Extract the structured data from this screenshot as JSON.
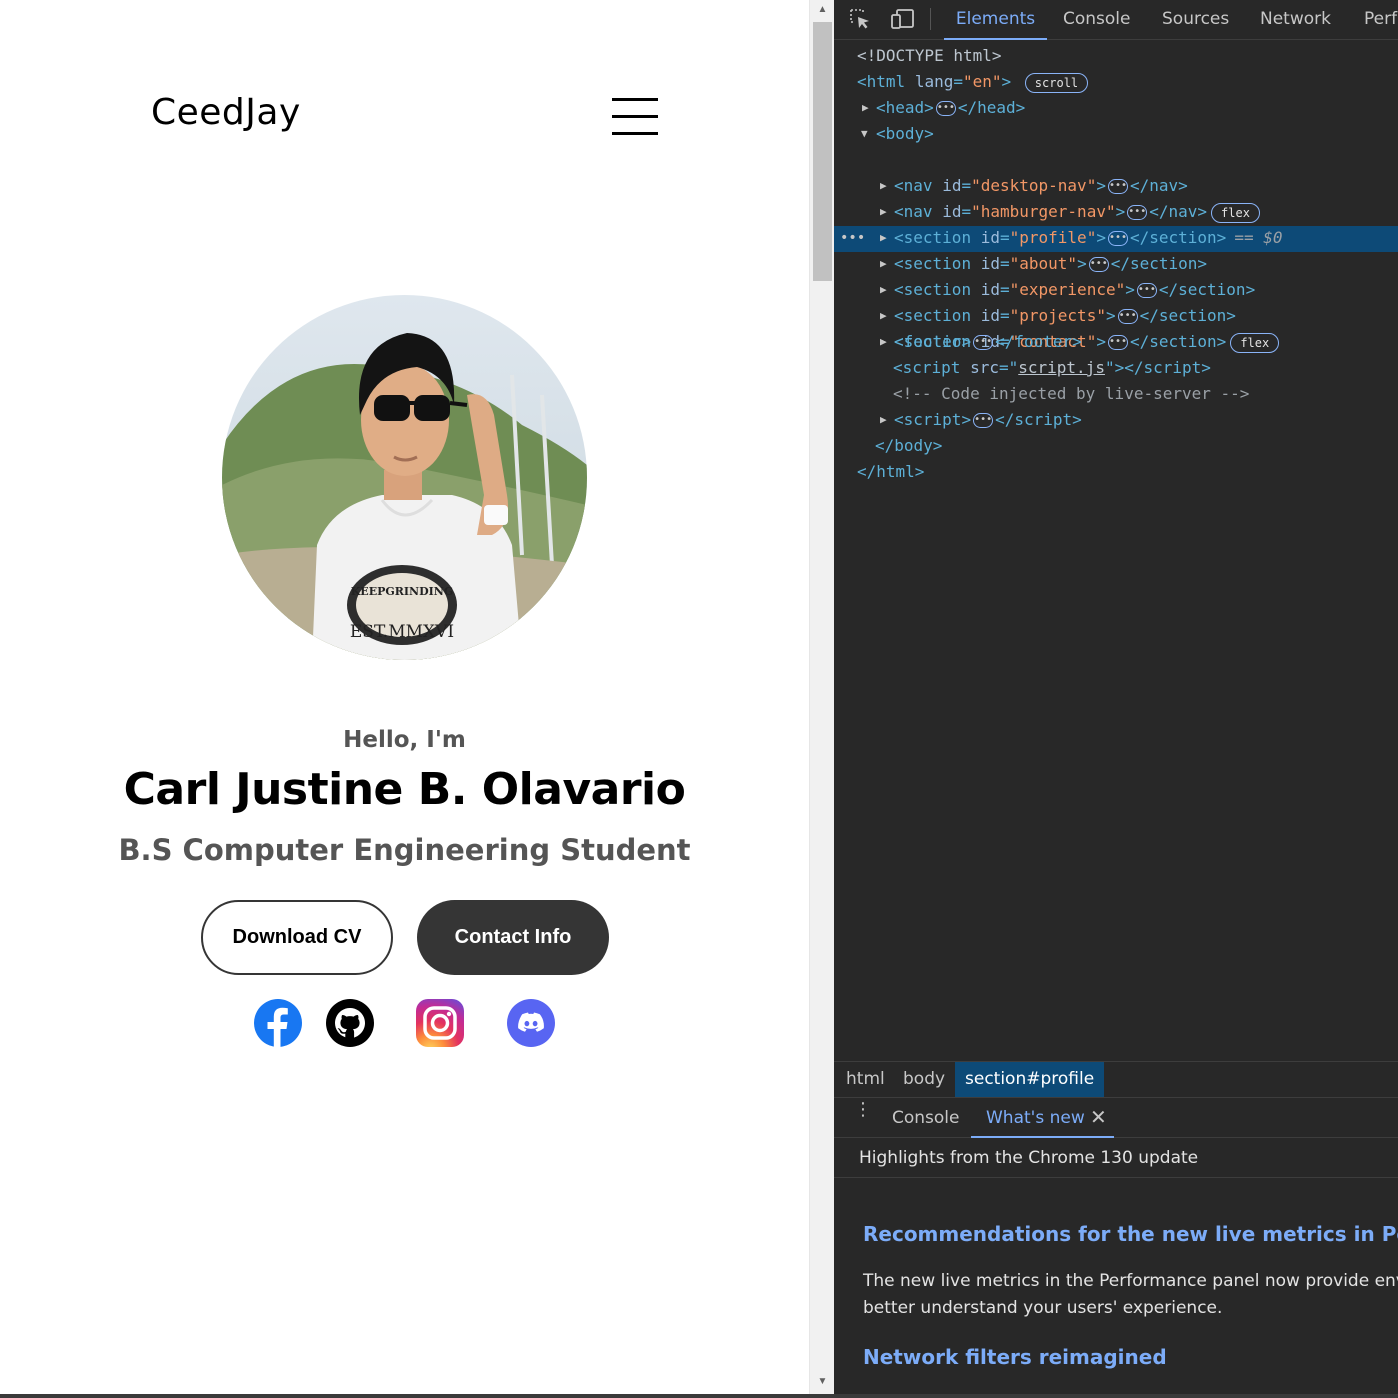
{
  "page": {
    "logo": "CeedJay",
    "hello": "Hello, I'm",
    "name": "Carl Justine B. Olavario",
    "title": "B.S Computer Engineering Student",
    "buttons": {
      "download_cv": "Download CV",
      "contact_info": "Contact Info"
    },
    "social": [
      "facebook-icon",
      "github-icon",
      "instagram-icon",
      "discord-icon"
    ],
    "photo_text": {
      "shirt_top": "KEEPGRINDING",
      "shirt_bottom": "EST.MMXVI"
    },
    "colors": {
      "button_dark": "#353535",
      "facebook": "#1877f2",
      "discord": "#5865f2"
    }
  },
  "devtools": {
    "tabs": [
      "Elements",
      "Console",
      "Sources",
      "Network",
      "Perfo"
    ],
    "active_tab": "Elements",
    "dom": {
      "doctype": "<!DOCTYPE html>",
      "html_open": {
        "tag": "<html",
        "attr": "lang",
        "value": "\"en\"",
        "badge": "scroll"
      },
      "head": "head",
      "body": "body",
      "nodes": [
        {
          "tag": "nav",
          "attr": "id",
          "value": "\"desktop-nav\"",
          "badge": ""
        },
        {
          "tag": "nav",
          "attr": "id",
          "value": "\"hamburger-nav\"",
          "badge": "flex"
        },
        {
          "tag": "section",
          "attr": "id",
          "value": "\"profile\"",
          "badge": "",
          "selected_marker": "== $0"
        },
        {
          "tag": "section",
          "attr": "id",
          "value": "\"about\"",
          "badge": ""
        },
        {
          "tag": "section",
          "attr": "id",
          "value": "\"experience\"",
          "badge": ""
        },
        {
          "tag": "section",
          "attr": "id",
          "value": "\"projects\"",
          "badge": ""
        },
        {
          "tag": "section",
          "attr": "id",
          "value": "\"contact\"",
          "badge": "flex"
        }
      ],
      "footer": "footer",
      "script_src": {
        "attr": "src",
        "value": "script.js"
      },
      "comment": "<!-- Code injected by live-server -->",
      "script2": "script",
      "body_close": "</body>",
      "html_close": "</html>"
    },
    "breadcrumbs": [
      "html",
      "body",
      "section#profile"
    ],
    "drawer": {
      "tabs": [
        "Console",
        "What's new"
      ],
      "active_tab": "What's new",
      "header": "Highlights from the Chrome 130 update",
      "h2_1": "Recommendations for the new live metrics in Perform",
      "p1_line1": "The new live metrics in the Performance panel now provide environ",
      "p1_line2": "better understand your users' experience.",
      "h2_2": "Network filters reimagined"
    },
    "colors": {
      "background": "#282828",
      "accent": "#7cacf8",
      "selection": "#0d4a77",
      "tag": "#5db0d7",
      "attr_value": "#f29766"
    }
  }
}
